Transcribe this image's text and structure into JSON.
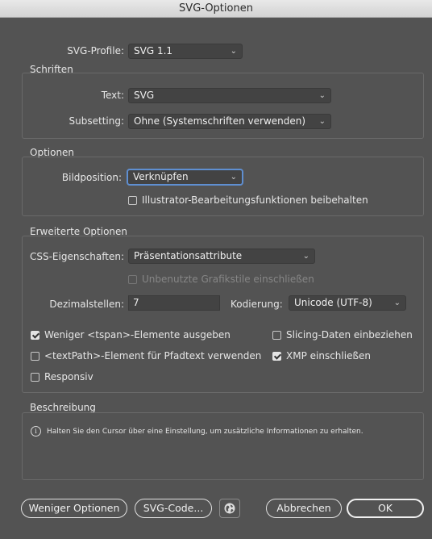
{
  "window": {
    "title": "SVG-Optionen"
  },
  "profile": {
    "label": "SVG-Profile:",
    "value": "SVG 1.1"
  },
  "fonts": {
    "title": "Schriften",
    "text_label": "Text:",
    "text_value": "SVG",
    "subsetting_label": "Subsetting:",
    "subsetting_value": "Ohne (Systemschriften verwenden)"
  },
  "options": {
    "title": "Optionen",
    "image_location_label": "Bildposition:",
    "image_location_value": "Verknüpfen",
    "preserve_label": "Illustrator-Bearbeitungsfunktionen beibehalten",
    "preserve_checked": false
  },
  "advanced": {
    "title": "Erweiterte Optionen",
    "css_label": "CSS-Eigenschaften:",
    "css_value": "Präsentationsattribute",
    "unused_styles_label": "Unbenutzte Grafikstile einschließen",
    "unused_styles_checked": false,
    "decimal_label": "Dezimalstellen:",
    "decimal_value": "7",
    "encoding_label": "Kodierung:",
    "encoding_value": "Unicode (UTF-8)",
    "checks": {
      "tspan": {
        "label": "Weniger <tspan>-Elemente ausgeben",
        "checked": true
      },
      "slicing": {
        "label": "Slicing-Daten einbeziehen",
        "checked": false
      },
      "textpath": {
        "label": "<textPath>-Element für Pfadtext verwenden",
        "checked": false
      },
      "xmp": {
        "label": "XMP einschließen",
        "checked": true
      },
      "responsive": {
        "label": "Responsiv",
        "checked": false
      }
    }
  },
  "description": {
    "title": "Beschreibung",
    "text": "Halten Sie den Cursor über eine Einstellung, um zusätzliche Informationen zu erhalten."
  },
  "buttons": {
    "fewer_options": "Weniger Optionen",
    "svg_code": "SVG-Code...",
    "cancel": "Abbrechen",
    "ok": "OK"
  },
  "icons": {
    "globe": "globe-icon",
    "info": "info-icon",
    "chevron": "chevron-down-icon"
  },
  "colors": {
    "background": "#535353",
    "focus": "#5f8fd1"
  }
}
